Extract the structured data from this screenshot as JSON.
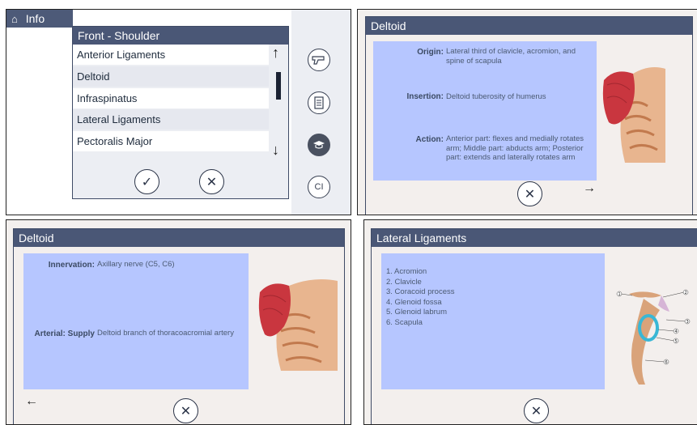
{
  "panel1": {
    "topbar_label": "Info",
    "dropdown": {
      "title": "Front - Shoulder",
      "items": [
        "Anterior Ligaments",
        "Deltoid",
        "Infraspinatus",
        "Lateral Ligaments",
        "Pectoralis Major"
      ]
    },
    "side_buttons": {
      "ci_label": "CI"
    },
    "icons": {
      "home": "home-icon",
      "up": "arrow-up-icon",
      "down": "arrow-down-icon",
      "ok": "check-icon",
      "cancel": "close-icon"
    }
  },
  "panel2": {
    "title": "Deltoid",
    "origin_label": "Origin:",
    "origin_value": "Lateral third of clavicle, acromion, and spine of scapula",
    "insertion_label": "Insertion:",
    "insertion_value": "Deltoid tuberosity of humerus",
    "action_label": "Action:",
    "action_value": "Anterior part: flexes and medially rotates arm; Middle part: abducts arm; Posterior part: extends and laterally rotates arm"
  },
  "panel3": {
    "title": "Deltoid",
    "innervation_label": "Innervation:",
    "innervation_value": "Axillary nerve (C5, C6)",
    "arterial_label": "Arterial: Supply",
    "arterial_value": "Deltoid branch of thoracoacromial artery"
  },
  "panel4": {
    "title": "Lateral Ligaments",
    "items": [
      "1. Acromion",
      "2. Clavicle",
      "3. Coracoid process",
      "4. Glenoid fossa",
      "5. Glenoid labrum",
      "6. Scapula"
    ],
    "diagram_numbers": [
      "1",
      "2",
      "3",
      "4",
      "5",
      "6"
    ]
  },
  "colors": {
    "titlebar": "#4d5a78",
    "bluebox": "#b6c6ff",
    "muscle": "#c9363f",
    "bone": "#d9a37a",
    "labrum": "#39b7d5"
  }
}
